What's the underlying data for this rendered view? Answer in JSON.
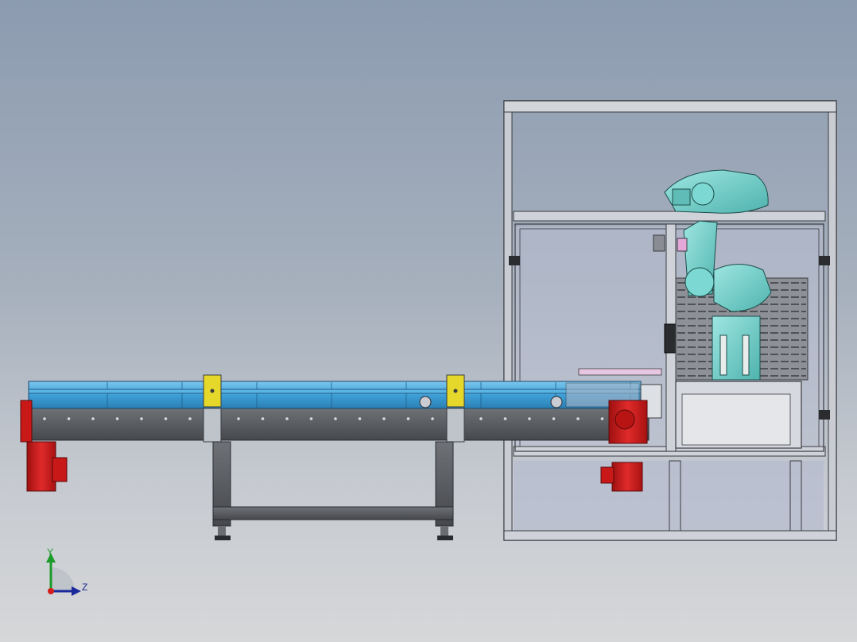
{
  "viewport": {
    "triad": {
      "y_label": "Y",
      "z_label": "Z"
    }
  },
  "colors": {
    "background_top": "#8c9bb0",
    "background_bottom": "#d6d7d9",
    "conveyor_belt": "#3fa0d8",
    "frame_steel": "#5a5d62",
    "motor_red": "#d41e1e",
    "bracket_yellow": "#e6d82a",
    "robot_teal": "#6fd1cc",
    "enclosure_glass": "#b9bfd2"
  },
  "icons": {
    "axis_triad": "axis-triad-icon"
  }
}
